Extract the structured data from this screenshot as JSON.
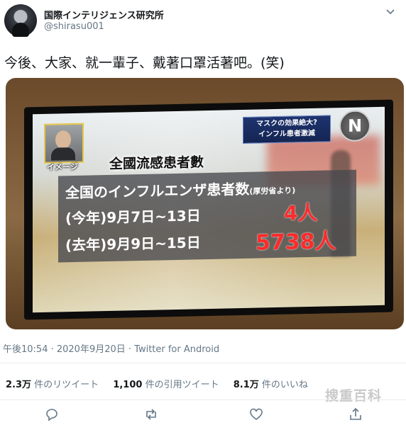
{
  "tweet": {
    "display_name": "国際インテリジェンス研究所",
    "handle": "@shirasu001",
    "text": "今後、大家、就一輩子、戴著口罩活著吧。(笑)",
    "timestamp": "午後10:54 · 2020年9月20日 · Twitter for Android"
  },
  "image": {
    "thumb_label": "イメージ",
    "banner_line1": "マスクの効果絶大?",
    "banner_line2": "インフル患者激減",
    "logo_letter": "N",
    "overlay_title": "全國流感患者數",
    "row1_main": "全国のインフルエンザ患者数",
    "row1_note": "(厚労省より)",
    "row2_label": "(今年)9月7日~13日",
    "row2_value": "4人",
    "row3_label": "(去年)9月9日~15日",
    "row3_value": "5738人"
  },
  "stats": [
    {
      "count": "2.3万",
      "label": "件のリツイート"
    },
    {
      "count": "1,100",
      "label": "件の引用ツイート"
    },
    {
      "count": "8.1万",
      "label": "件のいいね"
    }
  ],
  "actions": [
    "reply-icon",
    "retweet-icon",
    "like-icon",
    "share-icon"
  ],
  "watermark": "搜重百科",
  "colors": {
    "count_red": "#ff2a2a",
    "meta_gray": "#657786",
    "banner_blue": "#1e3470"
  }
}
